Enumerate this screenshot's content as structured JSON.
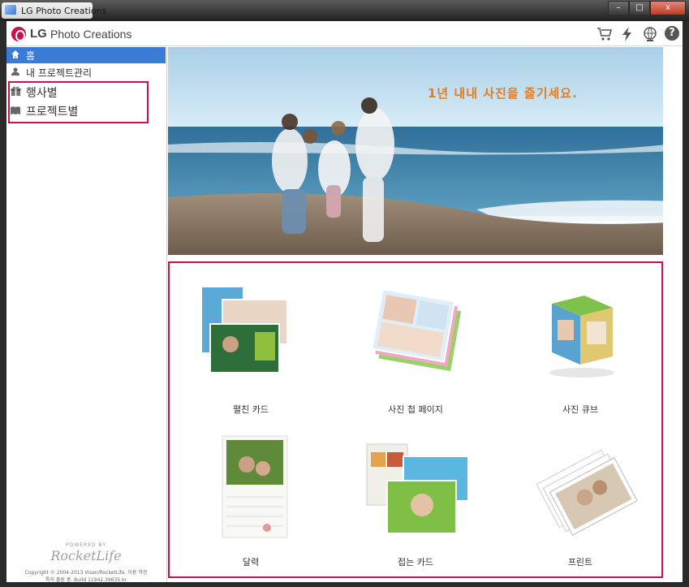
{
  "window": {
    "title": "LG Photo Creations",
    "buttons": [
      "–",
      "□",
      "x"
    ]
  },
  "header": {
    "logo_mark": "LG",
    "logo_name": "Photo Creations",
    "icons": [
      "cart-icon",
      "lightning-icon",
      "globe-icon",
      "help-icon"
    ],
    "help_glyph": "?"
  },
  "sidebar": {
    "items": [
      {
        "label": "홈",
        "icon": "home-icon",
        "active": true
      },
      {
        "label": "내 프로젝트관리",
        "icon": "user-icon",
        "active": false
      },
      {
        "label": "행사별",
        "icon": "gift-icon",
        "active": false
      },
      {
        "label": "프로젝트별",
        "icon": "book-icon",
        "active": false
      }
    ],
    "powered_by": "POWERED BY",
    "rocketlife": "RocketLife",
    "copyright": "Copyright © 2004-2013 Visan/RocketLife. 이용 약관",
    "build": "특허 출원 중. Build 11942.39635 kr"
  },
  "banner": {
    "headline": "1년 내내 사진을 즐기세요."
  },
  "products": [
    {
      "label": "펼친 카드",
      "name": "flat-card"
    },
    {
      "label": "사진 첩 페이지",
      "name": "photo-album-page"
    },
    {
      "label": "사진 큐브",
      "name": "photo-cube"
    },
    {
      "label": "달력",
      "name": "calendar"
    },
    {
      "label": "접는 카드",
      "name": "folded-card"
    },
    {
      "label": "프린트",
      "name": "print"
    }
  ],
  "colors": {
    "accent": "#c8124b",
    "active_nav": "#3b7bd4",
    "headline": "#e57c1e"
  }
}
